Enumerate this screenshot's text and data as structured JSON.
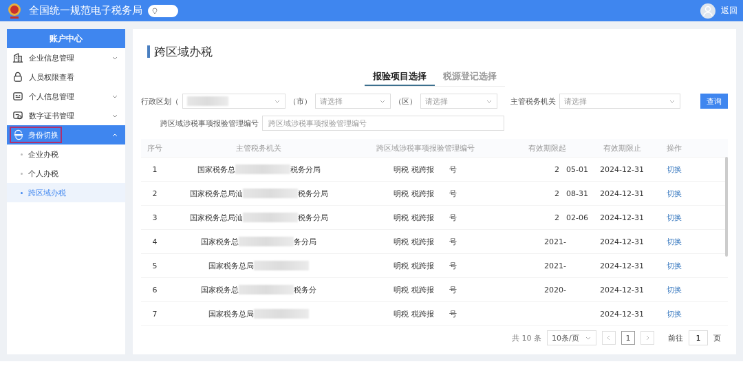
{
  "header": {
    "title": "全国统一规范电子税务局",
    "back": "返回"
  },
  "sidebar": {
    "title": "账户中心",
    "items": [
      {
        "label": "企业信息管理",
        "expanded": false,
        "selected": false
      },
      {
        "label": "人员权限查看",
        "selected": false
      },
      {
        "label": "个人信息管理",
        "expanded": false,
        "selected": false
      },
      {
        "label": "数字证书管理",
        "expanded": false,
        "selected": false
      },
      {
        "label": "身份切换",
        "expanded": true,
        "selected": true,
        "children": [
          {
            "label": "企业办税",
            "selected": false
          },
          {
            "label": "个人办税",
            "selected": false
          },
          {
            "label": "跨区域办税",
            "selected": true
          }
        ]
      }
    ]
  },
  "page_title": "跨区域办税",
  "tabs": [
    {
      "label": "报验项目选择",
      "selected": true
    },
    {
      "label": "税源登记选择",
      "selected": false
    }
  ],
  "filters": {
    "region_label": "行政区划（",
    "city_label": "（市）",
    "city_placeholder": "请选择",
    "district_label": "（区）",
    "district_placeholder": "请选择",
    "authority_label": "主管税务机关",
    "authority_placeholder": "请选择",
    "query_button": "查询",
    "number_label": "跨区域涉税事项报验管理编号",
    "number_placeholder": "跨区域涉税事项报验管理编号"
  },
  "table": {
    "columns": [
      "序号",
      "主管税务机关",
      "跨区域涉税事项报验管理编号",
      "有效期限起",
      "有效期限止",
      "操作"
    ],
    "rows": [
      {
        "index": "1",
        "agency_start": "国家税务总",
        "agency_end": "税务分局",
        "code_start": "明税 税跨报",
        "code_end": "号",
        "start_a": "2",
        "start_b": "05-01",
        "end": "2024-12-31",
        "action": "切换"
      },
      {
        "index": "2",
        "agency_start": "国家税务总局汕",
        "agency_end": "税务分局",
        "code_start": "明税 税跨报",
        "code_end": "号",
        "start_a": "2",
        "start_b": "08-31",
        "end": "2024-12-31",
        "action": "切换"
      },
      {
        "index": "3",
        "agency_start": "国家税务总局汕",
        "agency_end": "税务分局",
        "code_start": "明税 税跨报",
        "code_end": "号",
        "start_a": "2",
        "start_b": "02-06",
        "end": "2024-12-31",
        "action": "切换"
      },
      {
        "index": "4",
        "agency_start": "国家税务总",
        "agency_end": "务分局",
        "code_start": "明税 税跨报",
        "code_end": "号",
        "start_a": "2021-",
        "end": "2024-12-31",
        "action": "切换"
      },
      {
        "index": "5",
        "agency_start": "国家税务总局",
        "code_start": "明税 税跨报",
        "code_end": "号",
        "start_a": "2021-",
        "end": "2024-12-31",
        "action": "切换"
      },
      {
        "index": "6",
        "agency_start": "国家税务总",
        "agency_end": "税务分",
        "code_start": "明税 税跨报",
        "code_end": "号",
        "start_a": "2020-",
        "end": "2024-12-31",
        "action": "切换"
      },
      {
        "index": "7",
        "agency_start": "国家税务总局",
        "code_start": "明税 税跨报",
        "code_end": "号",
        "end": "2024-12-31",
        "action": "切换"
      }
    ]
  },
  "pagination": {
    "total": "共 10 条",
    "page_size": "10条/页",
    "pages": [
      {
        "label": "1",
        "selected": true
      }
    ],
    "goto_label": "前往",
    "goto_value": "1",
    "page_unit": "页"
  }
}
